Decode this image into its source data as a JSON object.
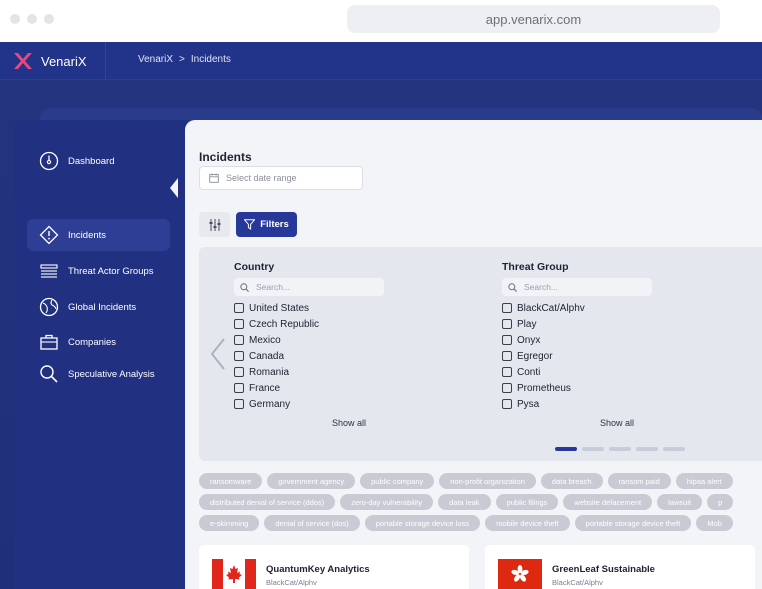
{
  "browser": {
    "url": "app.venarix.com"
  },
  "app": {
    "name": "VenariX",
    "breadcrumb": {
      "root": "VenariX",
      "separator": ">",
      "current": "Incidents"
    }
  },
  "sidebar": {
    "items": [
      {
        "label": "Dashboard",
        "icon": "dashboard-gauge-icon",
        "active": false
      },
      {
        "label": "Incidents",
        "icon": "warning-diamond-icon",
        "active": true
      },
      {
        "label": "Threat Actor Groups",
        "icon": "group-icon",
        "active": false
      },
      {
        "label": "Global Incidents",
        "icon": "globe-icon",
        "active": false
      },
      {
        "label": "Companies",
        "icon": "briefcase-icon",
        "active": false
      },
      {
        "label": "Speculative Analysis",
        "icon": "search-icon",
        "active": false
      }
    ]
  },
  "main": {
    "title": "Incidents",
    "date_placeholder": "Select date range",
    "filters_label": "Filters",
    "country": {
      "title": "Country",
      "search_placeholder": "Search...",
      "options": [
        "United States",
        "Czech Republic",
        "Mexico",
        "Canada",
        "Romania",
        "France",
        "Germany"
      ],
      "show_all": "Show all"
    },
    "threat_group": {
      "title": "Threat Group",
      "search_placeholder": "Search...",
      "options": [
        "BlackCat/Alphv",
        "Play",
        "Onyx",
        "Egregor",
        "Conti",
        "Prometheus",
        "Pysa"
      ],
      "show_all": "Show all"
    },
    "pager": {
      "pages": 5,
      "current": 1
    },
    "tags": [
      [
        "ransomware",
        "government agency",
        "public company",
        "non-profit organization",
        "data breach",
        "ransom paid",
        "hipaa alert"
      ],
      [
        "distributed denial of service (ddos)",
        "zero-day vulnerability",
        "data leak",
        "public filings",
        "website defacement",
        "lawsuit",
        "p"
      ],
      [
        "e-skimming",
        "denial of service (dos)",
        "portable storage device loss",
        "mobile device theft",
        "portable storage device theft",
        "Mob"
      ]
    ],
    "cards": [
      {
        "name": "QuantumKey Analytics",
        "group": "BlackCat/Alphv",
        "flag": "canada-flag-icon"
      },
      {
        "name": "GreenLeaf Sustainable",
        "group": "BlackCat/Alphv",
        "flag": "hong-kong-flag-icon"
      }
    ]
  },
  "colors": {
    "brand_navy": "#22338a",
    "accent_blue": "#26399a",
    "logo_pink": "#e8467c",
    "panel_bg": "#f3f4f8",
    "tag_bg": "#c8cbd3"
  }
}
